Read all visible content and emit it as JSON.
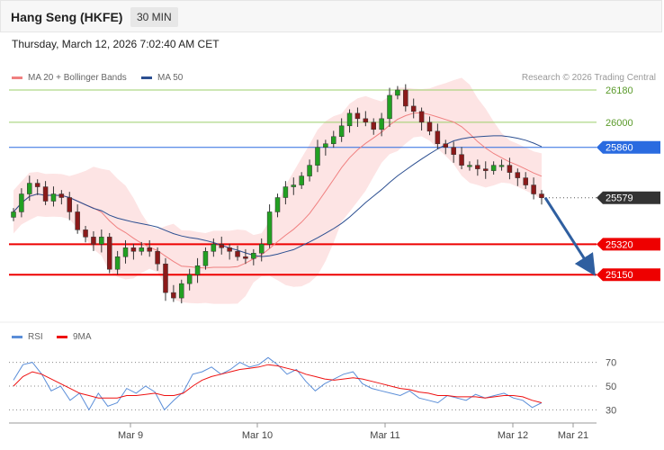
{
  "header": {
    "title": "Hang Seng (HKFE)",
    "timeframe": "30 MIN"
  },
  "datetime": "Thursday, March 12, 2026 7:02:40 AM CET",
  "legend": {
    "ma20": {
      "label": "MA 20 + Bollinger Bands",
      "color": "#f08080"
    },
    "ma50": {
      "label": "MA 50",
      "color": "#2c4f91"
    },
    "rsi": {
      "label": "RSI",
      "color": "#5b8ed8"
    },
    "ma9": {
      "label": "9MA",
      "color": "#ee1111"
    }
  },
  "credit": "Research © 2026 Trading Central",
  "chart_data": [
    {
      "type": "candlestick",
      "title": "",
      "ylim": [
        24900,
        26230
      ],
      "x_labels": [
        "Mar 9",
        "Mar 10",
        "Mar 11",
        "Mar 12",
        "Mar 21"
      ],
      "price_close": [
        25500,
        25600,
        25660,
        25640,
        25560,
        25600,
        25580,
        25500,
        25400,
        25360,
        25320,
        25360,
        25180,
        25250,
        25300,
        25280,
        25300,
        25280,
        25210,
        25050,
        25020,
        25100,
        25150,
        25200,
        25280,
        25320,
        25300,
        25280,
        25250,
        25240,
        25270,
        25320,
        25500,
        25580,
        25640,
        25650,
        25700,
        25760,
        25860,
        25880,
        25920,
        25980,
        26050,
        26020,
        26000,
        25960,
        26020,
        26150,
        26180,
        26090,
        26060,
        26000,
        25950,
        25880,
        25860,
        25820,
        25760,
        25760,
        25740,
        25730,
        25760,
        25760,
        25720,
        25690,
        25650,
        25600,
        25579
      ],
      "lines": [
        {
          "value": 26180,
          "label": "26180",
          "role": "resistance"
        },
        {
          "value": 26000,
          "label": "26000",
          "role": "resistance"
        },
        {
          "value": 25860,
          "label": "25860",
          "role": "pivot"
        },
        {
          "value": 25579,
          "label": "25579",
          "role": "last"
        },
        {
          "value": 25320,
          "label": "25320",
          "role": "support"
        },
        {
          "value": 25150,
          "label": "25150",
          "role": "support"
        }
      ],
      "forecast": {
        "from": 25579,
        "to": 25150
      }
    },
    {
      "type": "line",
      "title": "",
      "ylim": [
        25,
        78
      ],
      "y_ticks": [
        70,
        50,
        30
      ],
      "series": [
        {
          "name": "RSI",
          "values": [
            55,
            68,
            70,
            60,
            46,
            50,
            38,
            44,
            30,
            44,
            33,
            36,
            48,
            44,
            50,
            45,
            30,
            38,
            45,
            60,
            62,
            66,
            60,
            64,
            70,
            66,
            68,
            74,
            68,
            60,
            64,
            54,
            46,
            52,
            56,
            60,
            62,
            52,
            48,
            46,
            44,
            42,
            46,
            40,
            38,
            36,
            42,
            40,
            38,
            43,
            40,
            42,
            44,
            40,
            38,
            32,
            36
          ]
        },
        {
          "name": "9MA",
          "values": [
            50,
            58,
            62,
            60,
            56,
            52,
            48,
            44,
            42,
            40,
            40,
            40,
            42,
            42,
            43,
            44,
            42,
            42,
            44,
            50,
            55,
            58,
            60,
            62,
            64,
            65,
            66,
            68,
            67,
            65,
            63,
            60,
            58,
            56,
            55,
            56,
            57,
            56,
            54,
            52,
            50,
            48,
            47,
            45,
            44,
            42,
            42,
            41,
            41,
            41,
            40,
            41,
            42,
            42,
            41,
            38,
            36
          ]
        }
      ]
    }
  ]
}
